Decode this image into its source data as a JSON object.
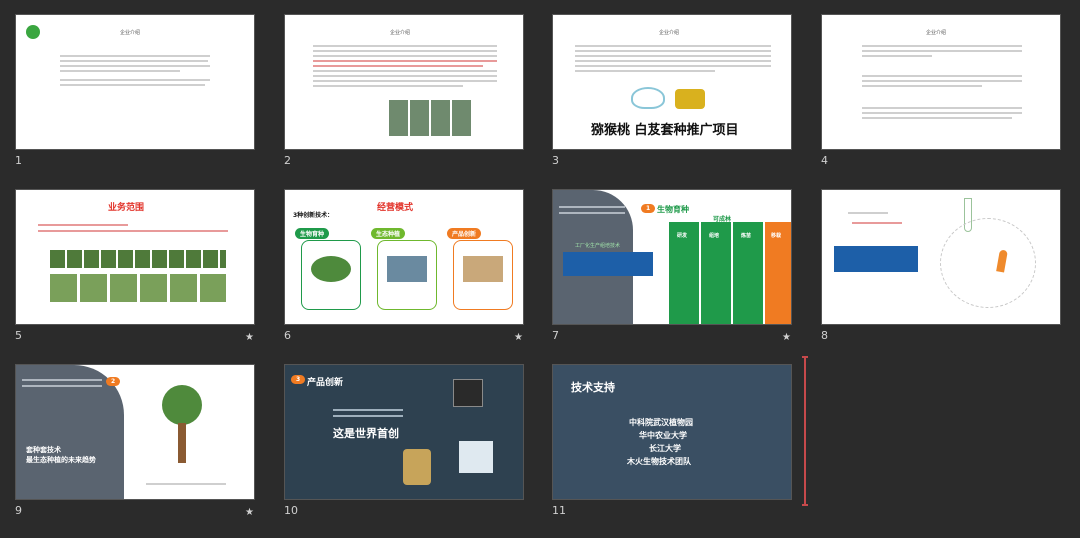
{
  "slides": [
    {
      "number": "1",
      "title": "企业介绍",
      "starred": false
    },
    {
      "number": "2",
      "title": "企业介绍",
      "starred": false
    },
    {
      "number": "3",
      "title": "企业介绍",
      "project_title": "猕猴桃 白芨套种推广项目",
      "starred": false
    },
    {
      "number": "4",
      "title": "企业介绍",
      "starred": false
    },
    {
      "number": "5",
      "title": "业务范围",
      "starred": true
    },
    {
      "number": "6",
      "title": "经营模式",
      "subtitle": "3种创新技术：",
      "labels": [
        "生物育种",
        "生态种植",
        "产品创新"
      ],
      "starred": true
    },
    {
      "number": "7",
      "title": "生物育种",
      "badge": "1",
      "subtitle": "工厂化生产组培技术",
      "section": "可成林",
      "columns": [
        "研发",
        "组培",
        "炼苗",
        "移栽"
      ],
      "starred": true
    },
    {
      "number": "8",
      "starred": false
    },
    {
      "number": "9",
      "badge": "2",
      "title_lines": [
        "套种套技术",
        "最生态种植的未来趋势"
      ],
      "starred": true
    },
    {
      "number": "10",
      "badge": "3",
      "title": "产品创新",
      "headline": "这是世界首创",
      "starred": false
    },
    {
      "number": "11",
      "title": "技术支持",
      "lines": [
        "中科院武汉植物园",
        "华中农业大学",
        "长江大学",
        "木火生物技术团队"
      ],
      "starred": false
    }
  ],
  "star_symbol": "★",
  "colors": {
    "background": "#2b2b2b",
    "green": "#1f9a4a",
    "orange": "#f07b22",
    "red": "#e2342b",
    "marker": "#c6494b"
  }
}
